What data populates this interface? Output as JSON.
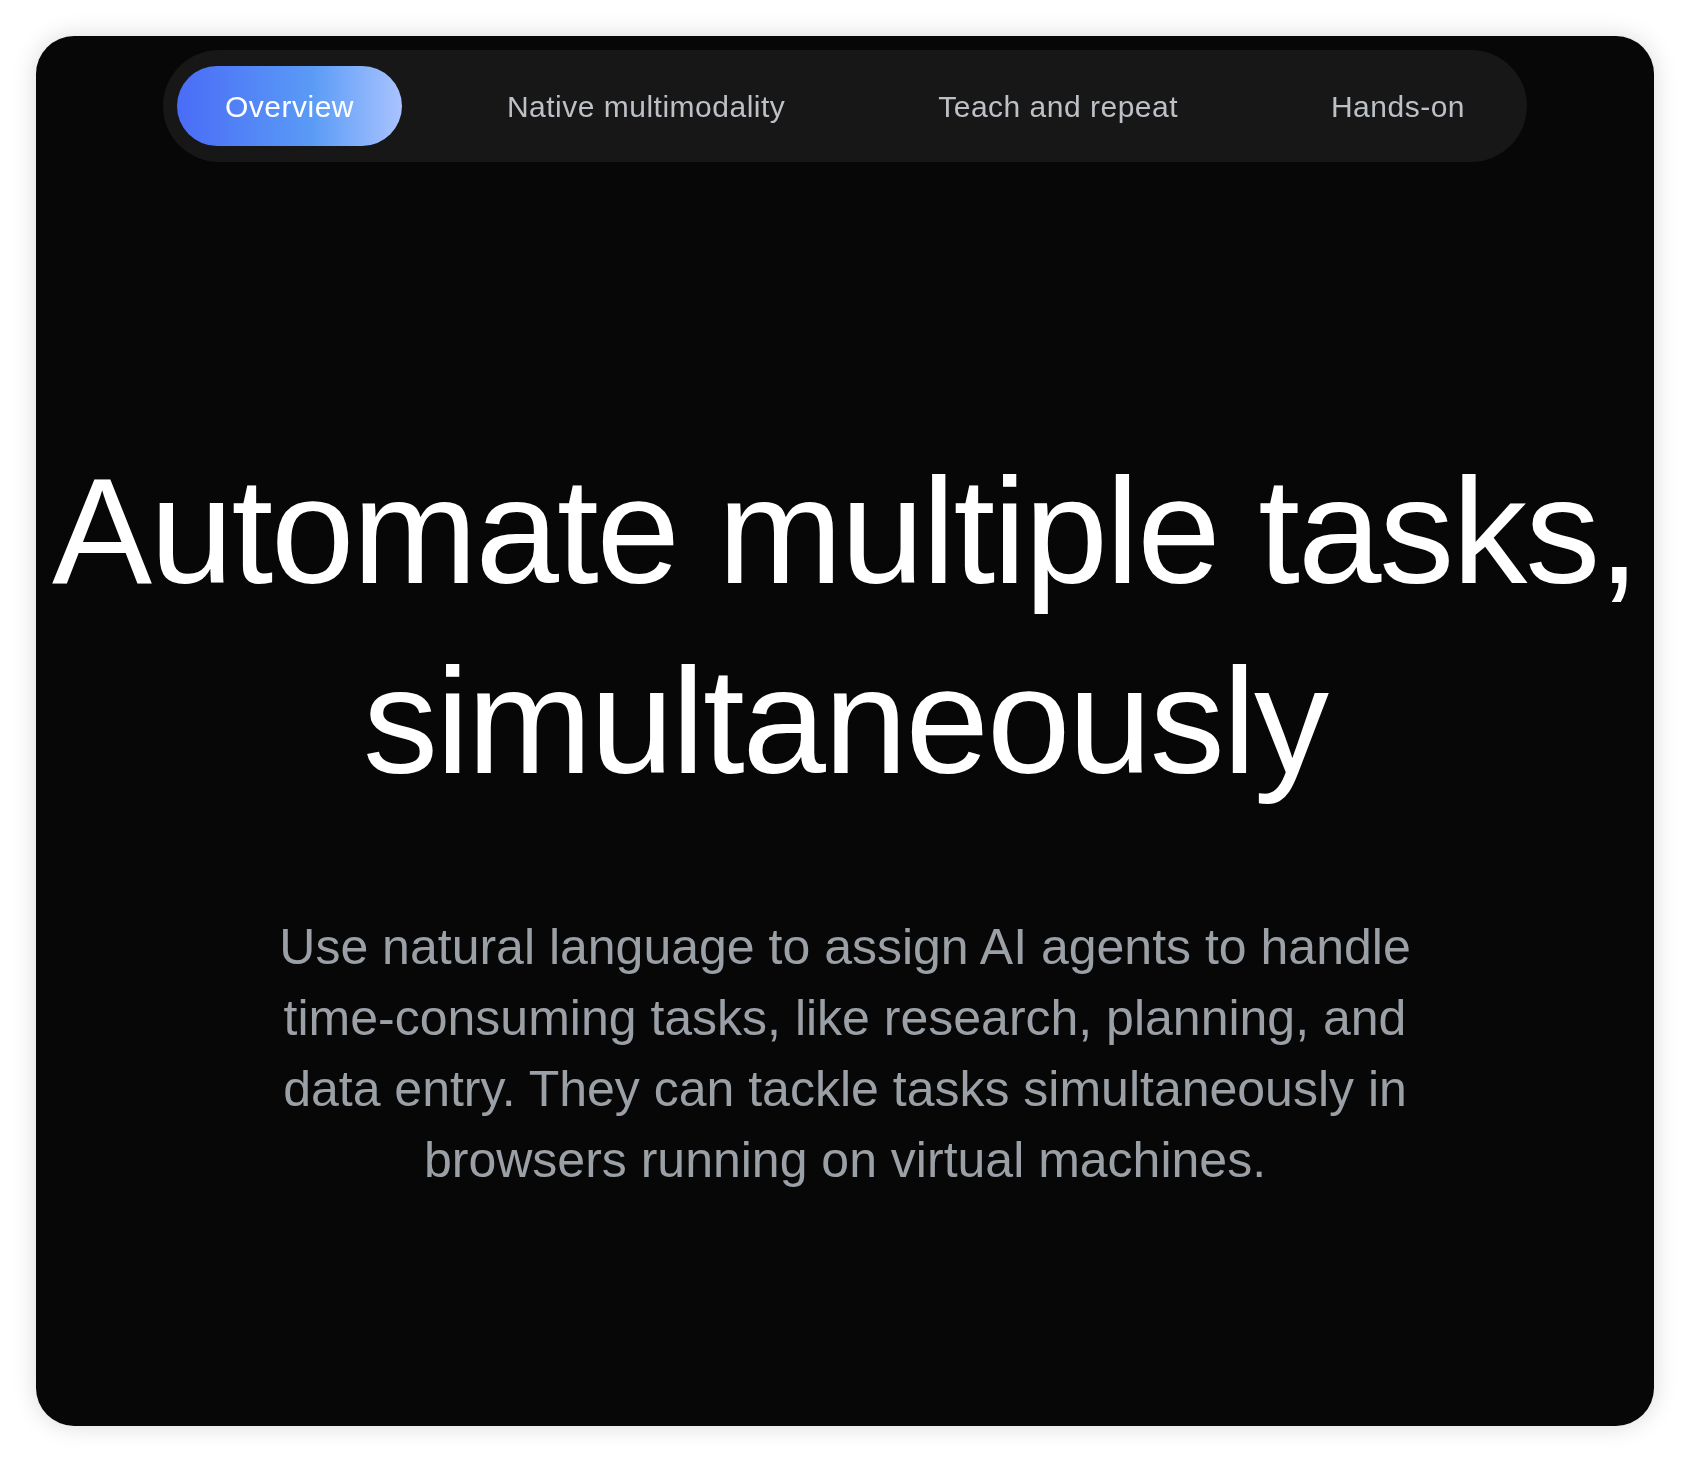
{
  "tabs": [
    {
      "label": "Overview",
      "selected": true
    },
    {
      "label": "Native multimodality",
      "selected": false
    },
    {
      "label": "Teach and repeat",
      "selected": false
    },
    {
      "label": "Hands-on",
      "selected": false
    }
  ],
  "heading": "Automate multiple tasks, simultaneously",
  "description": "Use natural language to assign AI agents to handle time-consuming tasks, like research, planning, and data entry. They can tackle tasks simultaneously in browsers running on virtual machines."
}
